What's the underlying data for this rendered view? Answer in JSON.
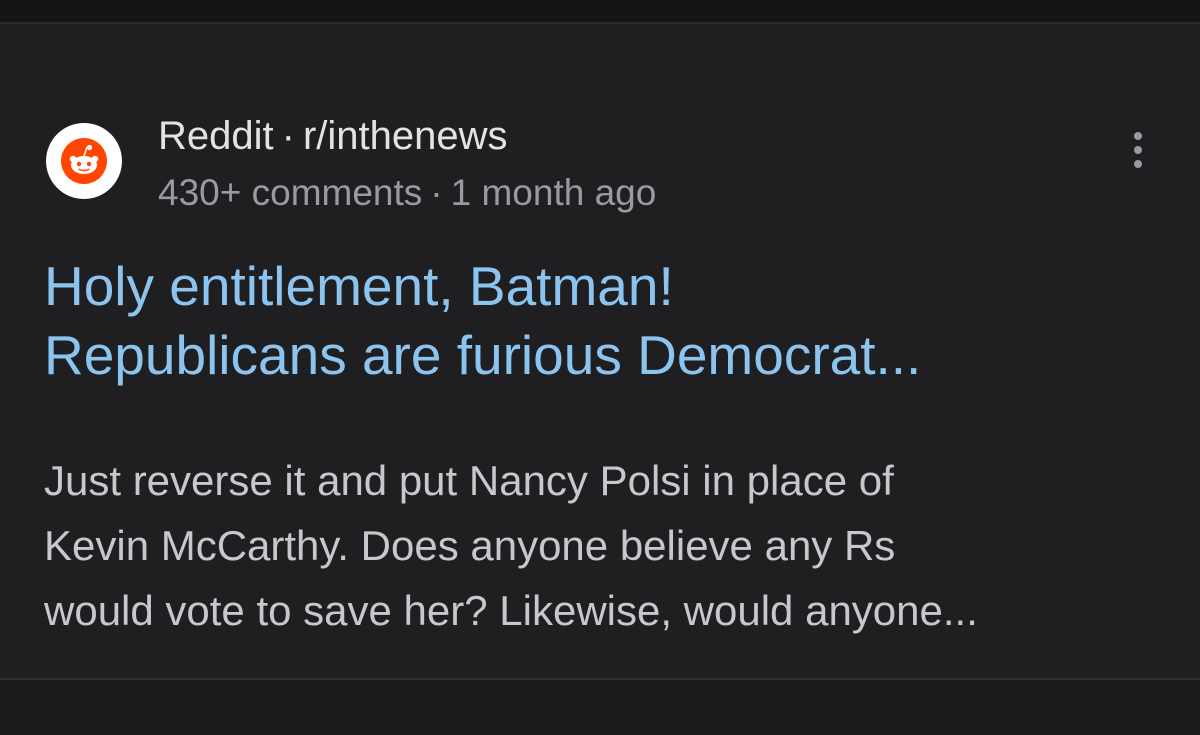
{
  "result": {
    "source_name": "Reddit",
    "separator": "·",
    "subreddit": "r/inthenews",
    "comments": "430+ comments",
    "age": "1 month ago",
    "headline_lines": [
      "Holy entitlement, Batman!",
      "Republicans are furious Democrat..."
    ],
    "snippet_lines": [
      "Just reverse it and put Nancy Polsi in place of",
      "Kevin McCarthy. Does anyone believe any Rs",
      "would vote to save her? Likewise, would anyone..."
    ],
    "icons": {
      "avatar": "reddit-logo-icon",
      "menu": "more-vert-icon"
    },
    "colors": {
      "headline": "#8cc4f0",
      "reddit_orange": "#ff4500",
      "background": "#1f1f21"
    }
  }
}
